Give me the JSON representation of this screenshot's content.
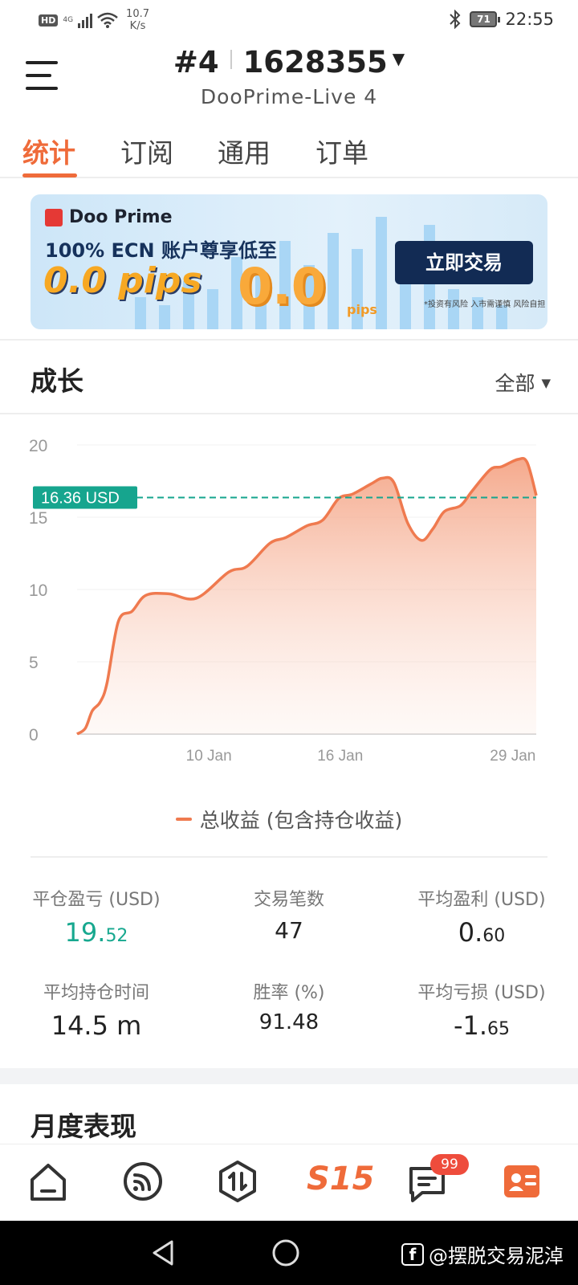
{
  "status_bar": {
    "hd": "HD",
    "network": "4G",
    "speed_value": "10.7",
    "speed_unit": "K/s",
    "battery": "71",
    "time": "22:55"
  },
  "header": {
    "account_prefix": "#4",
    "account_number": "1628355",
    "server": "DooPrime-Live 4"
  },
  "tabs": [
    {
      "label": "统计",
      "active": true
    },
    {
      "label": "订阅",
      "active": false
    },
    {
      "label": "通用",
      "active": false
    },
    {
      "label": "订单",
      "active": false
    }
  ],
  "banner": {
    "brand": "Doo Prime",
    "headline": "100% ECN 账户尊享低至",
    "pips": "0.0 pips",
    "big_value": "0.0",
    "big_unit": "pips",
    "cta": "立即交易",
    "disclaimer": "*投资有风险 入市需谨慎 风险自担"
  },
  "growth": {
    "title": "成长",
    "range": "全部",
    "legend": "总收益 (包含持仓收益)"
  },
  "chart_data": {
    "type": "area",
    "title": "",
    "xlabel": "",
    "ylabel": "",
    "ylim": [
      0,
      20
    ],
    "yticks": [
      "0",
      "5",
      "10",
      "15",
      "20"
    ],
    "xticks": [
      {
        "label": "10 Jan",
        "x": 0.287
      },
      {
        "label": "16 Jan",
        "x": 0.573
      },
      {
        "label": "29 Jan",
        "x": 0.949
      }
    ],
    "current_value": 16.36,
    "current_label": "16.36 USD",
    "series": [
      {
        "name": "总收益 (包含持仓收益)",
        "points": [
          [
            0.0,
            0.0
          ],
          [
            0.018,
            0.4
          ],
          [
            0.033,
            1.6
          ],
          [
            0.05,
            2.2
          ],
          [
            0.065,
            3.5
          ],
          [
            0.09,
            7.8
          ],
          [
            0.12,
            8.5
          ],
          [
            0.15,
            9.6
          ],
          [
            0.2,
            9.7
          ],
          [
            0.26,
            9.4
          ],
          [
            0.33,
            11.2
          ],
          [
            0.37,
            11.6
          ],
          [
            0.42,
            13.2
          ],
          [
            0.455,
            13.6
          ],
          [
            0.5,
            14.4
          ],
          [
            0.535,
            14.8
          ],
          [
            0.57,
            16.3
          ],
          [
            0.6,
            16.6
          ],
          [
            0.64,
            17.3
          ],
          [
            0.665,
            17.7
          ],
          [
            0.69,
            17.4
          ],
          [
            0.72,
            14.6
          ],
          [
            0.75,
            13.4
          ],
          [
            0.775,
            14.2
          ],
          [
            0.8,
            15.4
          ],
          [
            0.835,
            15.8
          ],
          [
            0.86,
            16.8
          ],
          [
            0.9,
            18.3
          ],
          [
            0.925,
            18.5
          ],
          [
            0.96,
            19.0
          ],
          [
            0.98,
            18.8
          ],
          [
            1.0,
            16.5
          ]
        ]
      }
    ],
    "line_color": "#ef7a4f",
    "reference_color": "#16a58e"
  },
  "stats": {
    "closed_pnl": {
      "label": "平仓盈亏 (USD)",
      "int": "19.",
      "frac": "52"
    },
    "trades": {
      "label": "交易笔数",
      "value": "47"
    },
    "avg_profit": {
      "label": "平均盈利 (USD)",
      "int": "0.",
      "frac": "60"
    },
    "avg_hold": {
      "label": "平均持仓时间",
      "value": "14.5 m"
    },
    "win_rate": {
      "label": "胜率 (%)",
      "value": "91.48"
    },
    "avg_loss": {
      "label": "平均亏损 (USD)",
      "int": "-1.",
      "frac": "65"
    }
  },
  "monthly": {
    "title": "月度表现"
  },
  "bottom_nav": {
    "items": [
      "home-icon",
      "signal-icon",
      "trade-icon",
      "s15-logo",
      "message-icon",
      "profile-icon"
    ],
    "s15_label": "S15",
    "message_badge": "99",
    "accent": "#ef6b3a"
  },
  "watermark": "@摆脱交易泥淖"
}
